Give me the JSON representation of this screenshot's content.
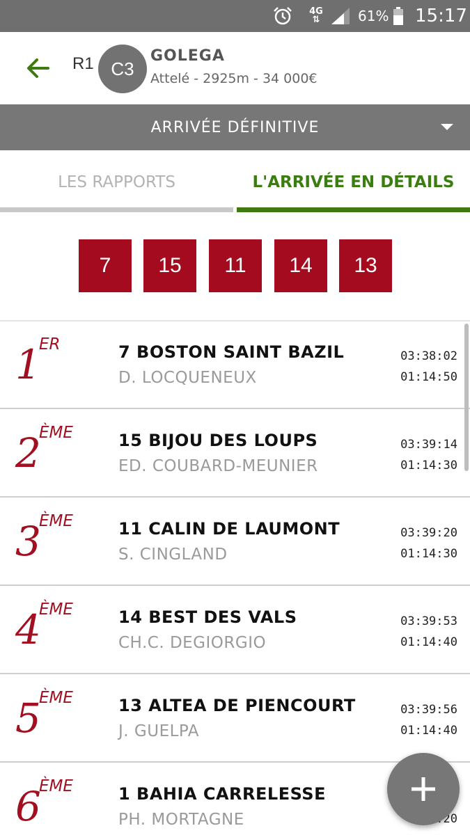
{
  "status_bar": {
    "network": "4G",
    "battery_percent": "61%",
    "time": "15:17"
  },
  "header": {
    "reunion": "R1",
    "course": "C3",
    "race_name": "GOLEGA",
    "race_info": "Attelé - 2925m - 34 000€"
  },
  "dropdown": {
    "label": "ARRIVÉE DÉFINITIVE"
  },
  "tabs": [
    {
      "label": "LES RAPPORTS",
      "active": false
    },
    {
      "label": "L'ARRIVÉE EN DÉTAILS",
      "active": true
    }
  ],
  "arrival_numbers": [
    "7",
    "15",
    "11",
    "14",
    "13"
  ],
  "results": [
    {
      "place": "1",
      "suffix": "ER",
      "horse": "7 BOSTON SAINT BAZIL",
      "driver": "D. LOCQUENEUX",
      "time": "03:38:02",
      "reduction": "01:14:50"
    },
    {
      "place": "2",
      "suffix": "ÈME",
      "horse": "15 BIJOU DES LOUPS",
      "driver": "ED. COUBARD-MEUNIER",
      "time": "03:39:14",
      "reduction": "01:14:30"
    },
    {
      "place": "3",
      "suffix": "ÈME",
      "horse": "11 CALIN DE LAUMONT",
      "driver": "S. CINGLAND",
      "time": "03:39:20",
      "reduction": "01:14:30"
    },
    {
      "place": "4",
      "suffix": "ÈME",
      "horse": "14 BEST DES VALS",
      "driver": "CH.C. DEGIORGIO",
      "time": "03:39:53",
      "reduction": "01:14:40"
    },
    {
      "place": "5",
      "suffix": "ÈME",
      "horse": "13 ALTEA DE PIENCOURT",
      "driver": "J. GUELPA",
      "time": "03:39:56",
      "reduction": "01:14:40"
    },
    {
      "place": "6",
      "suffix": "ÈME",
      "horse": "1 BAHIA CARRELESSE",
      "driver": "PH. MORTAGNE",
      "time": "",
      "reduction": ".20"
    }
  ],
  "colors": {
    "accent_green": "#3d7a12",
    "result_red": "#a50b1f",
    "bar_grey": "#777777"
  },
  "icons": {
    "back": "arrow-left-icon",
    "fab": "plus-icon"
  }
}
